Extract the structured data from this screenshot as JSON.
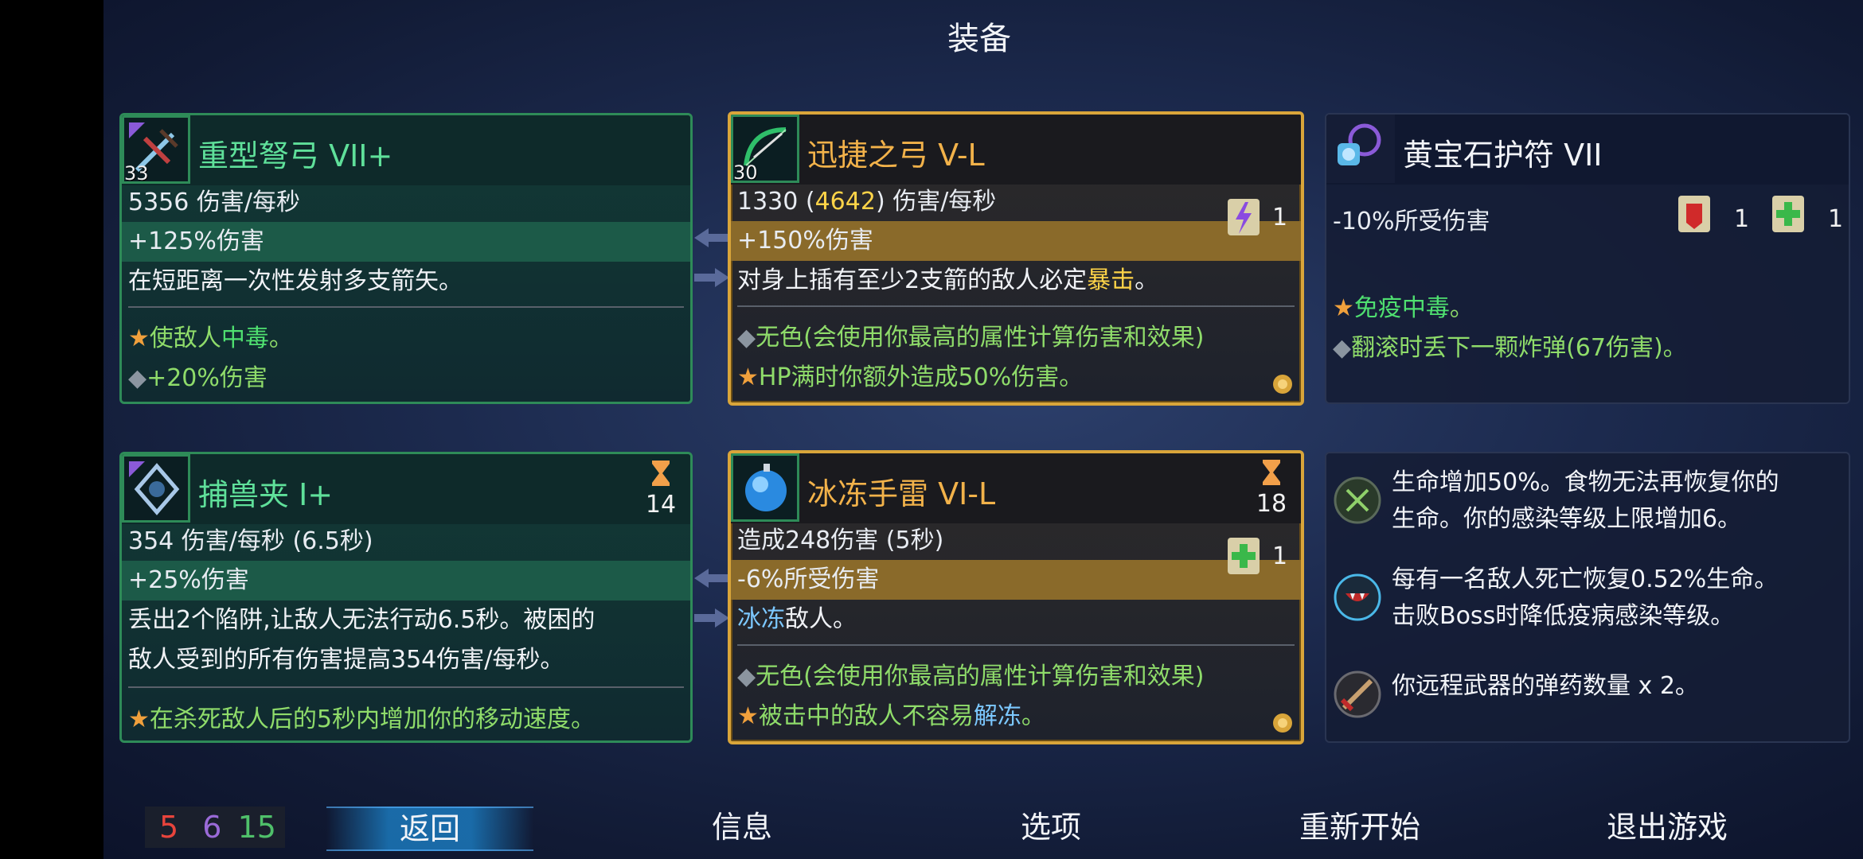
{
  "title": "装备",
  "weapon1": {
    "name": "重型弩弓 VII+",
    "level": "33",
    "dps": "5356 伤害/每秒",
    "bonus": "+125%伤害",
    "desc": "在短距离一次性发射多支箭矢。",
    "perk1_prefix": "使敌人",
    "perk1_hl": "中毒",
    "perk1_suffix": "。",
    "perk2": "+20%伤害"
  },
  "weapon2": {
    "name": "迅捷之弓 V-L",
    "level": "30",
    "dps_a": "1330 (",
    "dps_b": "4642",
    "dps_c": ") 伤害/每秒",
    "bonus": "+150%伤害",
    "scroll_count": "1",
    "desc_a": "对身上插有至少2支箭的敌人必定",
    "desc_hl": "暴击",
    "desc_b": "。",
    "perk1": "无色(会使用你最高的属性计算伤害和效果)",
    "perk2": "HP满时你额外造成50%伤害。"
  },
  "amulet": {
    "name": "黄宝石护符 VII",
    "stat": "-10%所受伤害",
    "scroll1_count": "1",
    "scroll2_count": "1",
    "perk1_hl": "免疫中毒",
    "perk1_suffix": "。",
    "perk2": "翻滚时丢下一颗炸弹(67伤害)。"
  },
  "skill1": {
    "name": "捕兽夹 I+",
    "timer": "14",
    "dps": "354 伤害/每秒 (6.5秒)",
    "bonus": "+25%伤害",
    "desc1": "丢出2个陷阱,让敌人无法行动6.5秒。被困的",
    "desc2": "敌人受到的所有伤害提高354伤害/每秒。",
    "perk1": "在杀死敌人后的5秒内增加你的移动速度。"
  },
  "skill2": {
    "name": "冰冻手雷 VI-L",
    "timer": "18",
    "dmg": "造成248伤害 (5秒)",
    "stat": "-6%所受伤害",
    "scroll_count": "1",
    "desc_hl": "冰冻",
    "desc_b": "敌人。",
    "perk1": "无色(会使用你最高的属性计算伤害和效果)",
    "perk2_a": "被击中的敌人不容易",
    "perk2_hl": "解冻",
    "perk2_b": "。"
  },
  "mutations": [
    {
      "line1": "生命增加50%。食物无法再恢复你的",
      "line2": "生命。你的感染等级上限增加6。"
    },
    {
      "line1": "每有一名敌人死亡恢复0.52%生命。",
      "line2": "击败Boss时降低疫病感染等级。"
    },
    {
      "line1": "你远程武器的弹药数量 x 2。",
      "line2": ""
    }
  ],
  "stats": {
    "brutality": "5",
    "tactics": "6",
    "survival": "15",
    "colors": {
      "brutality": "#e8443c",
      "tactics": "#9a6ad8",
      "survival": "#4fc06a"
    }
  },
  "nav": {
    "back": "返回",
    "info": "信息",
    "options": "选项",
    "restart": "重新开始",
    "quit": "退出游戏"
  }
}
